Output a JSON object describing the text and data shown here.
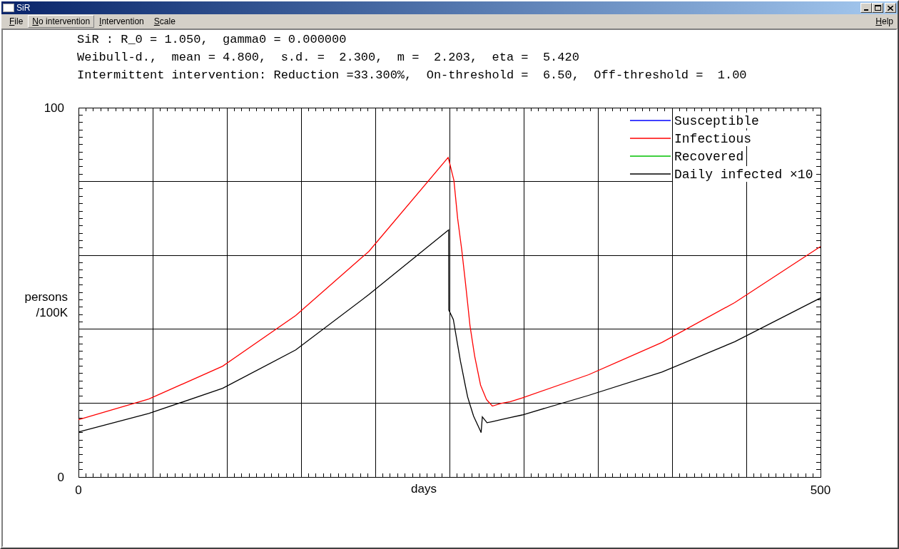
{
  "window": {
    "title": "SiR"
  },
  "menu": [
    {
      "label": "File",
      "selected": false
    },
    {
      "label": "No intervention",
      "selected": true
    },
    {
      "label": "Intervention",
      "selected": false
    },
    {
      "label": "Scale",
      "selected": false
    }
  ],
  "help_menu": "Help",
  "header_lines": [
    "SiR : R_0 = 1.050,  gamma0 = 0.000000",
    "Weibull-d.,  mean = 4.800,  s.d. =  2.300,  m =  2.203,  eta =  5.420",
    "Intermittent intervention: Reduction =33.300%,  On-threshold =  6.50,  Off-threshold =  1.00"
  ],
  "plot": {
    "chart_data": {
      "type": "line",
      "xlabel": "days",
      "ylabel": "persons\n/100K",
      "xlim": [
        0,
        500
      ],
      "ylim": [
        0,
        100
      ],
      "xticks": [
        0,
        500
      ],
      "yticks": [
        0,
        100
      ],
      "legend": "upper right",
      "x": [
        0,
        47.4,
        97.1,
        146.4,
        195.7,
        249.1,
        249.4,
        249.5,
        252.6,
        253,
        255.5,
        257.4,
        258.2,
        260.6,
        262.2,
        263.8,
        266.2,
        267,
        270.9,
        271.3,
        272.1,
        274.9,
        275.3,
        278.9,
        284.5,
        290.9,
        299,
        343.8,
        393.1,
        442.1,
        500
      ],
      "series": [
        {
          "name": "Susceptible",
          "color": "#0000ff",
          "values": [
            null,
            null,
            null,
            null,
            null,
            null,
            null,
            null,
            null,
            null,
            null,
            null,
            null,
            null,
            null,
            null,
            null,
            null,
            null,
            null,
            null,
            null,
            null,
            null,
            null,
            null,
            null,
            null,
            null,
            null,
            null
          ]
        },
        {
          "name": "Infectious",
          "color": "#ff0000",
          "values": [
            15.5,
            21.1,
            30.0,
            43.7,
            61.1,
            86.5,
            86.0,
            85.9,
            80.9,
            80.3,
            70,
            64.1,
            61.6,
            53.2,
            47.1,
            41,
            34.7,
            32.6,
            24.9,
            24.5,
            23.7,
            21,
            20.8,
            19.2,
            19.9,
            20.4,
            21.4,
            27.7,
            36.4,
            47.2,
            62.4
          ]
        },
        {
          "name": "Recovered",
          "color": "#00c000",
          "values": [
            null,
            null,
            null,
            null,
            null,
            null,
            null,
            null,
            null,
            null,
            null,
            null,
            null,
            null,
            null,
            null,
            null,
            null,
            null,
            null,
            null,
            null,
            null,
            null,
            null,
            null,
            null,
            null,
            null,
            null,
            null
          ]
        },
        {
          "name": "Daily infected ×10",
          "color": "#000000",
          "values": [
            12.2,
            17.2,
            24.0,
            34.4,
            49.4,
            66.8,
            66.9,
            45.2,
            42.6,
            41.7,
            35.8,
            31.3,
            29.7,
            24.9,
            21.7,
            19.6,
            16.5,
            15.8,
            12.4,
            12.0,
            16.3,
            14.9,
            14.7,
            15.0,
            15.5,
            16.1,
            16.8,
            22.1,
            28.4,
            36.6,
            48.5
          ]
        }
      ]
    }
  }
}
